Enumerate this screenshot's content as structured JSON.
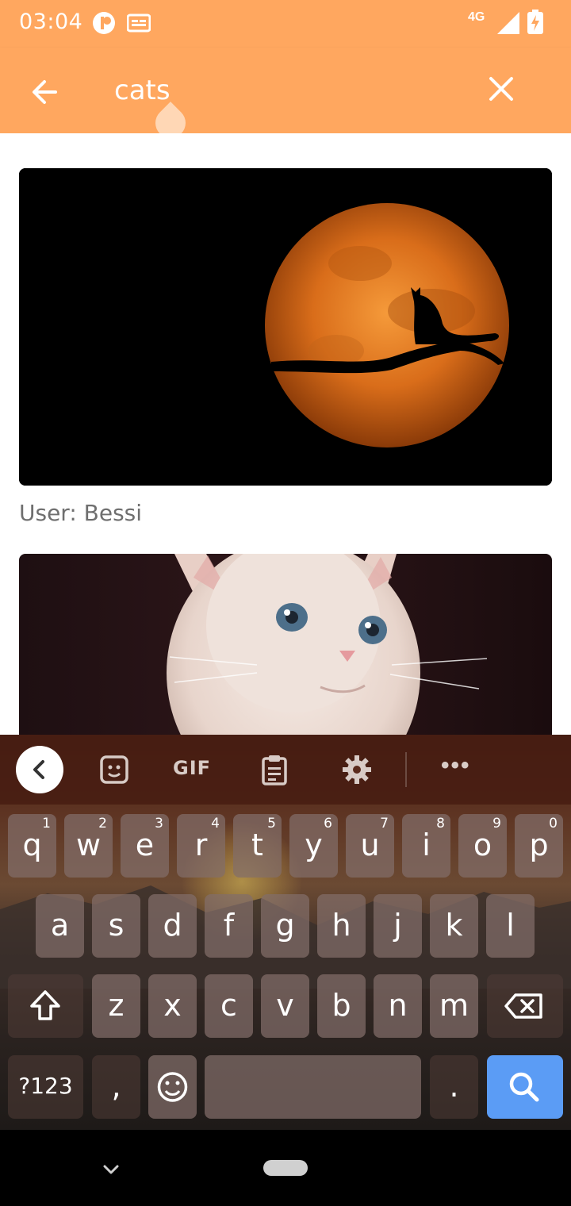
{
  "status_bar": {
    "time": "03:04",
    "network": "4G"
  },
  "search": {
    "query": "cats"
  },
  "results": [
    {
      "image": "moon-cat-photo",
      "user_label": "User: Bessi"
    },
    {
      "image": "white-kitten-photo",
      "user_label": ""
    }
  ],
  "keyboard": {
    "toolbar": {
      "gif_label": "GIF"
    },
    "row1": [
      {
        "key": "q",
        "hint": "1"
      },
      {
        "key": "w",
        "hint": "2"
      },
      {
        "key": "e",
        "hint": "3"
      },
      {
        "key": "r",
        "hint": "4"
      },
      {
        "key": "t",
        "hint": "5"
      },
      {
        "key": "y",
        "hint": "6"
      },
      {
        "key": "u",
        "hint": "7"
      },
      {
        "key": "i",
        "hint": "8"
      },
      {
        "key": "o",
        "hint": "9"
      },
      {
        "key": "p",
        "hint": "0"
      }
    ],
    "row2": [
      "a",
      "s",
      "d",
      "f",
      "g",
      "h",
      "j",
      "k",
      "l"
    ],
    "row3": [
      "z",
      "x",
      "c",
      "v",
      "b",
      "n",
      "m"
    ],
    "row4": {
      "symbols": "?123",
      "comma": ",",
      "period": "."
    }
  },
  "colors": {
    "accent": "#ffa75f",
    "action_key": "#5b9cf5"
  }
}
